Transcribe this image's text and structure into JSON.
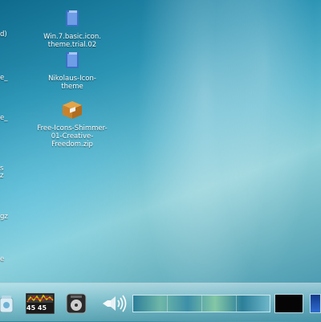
{
  "desktop": {
    "icons": [
      {
        "label_line1": "Win.7.basic.icon.",
        "label_line2": "theme.trial.02"
      },
      {
        "label_line1": "Nikolaus-Icon-",
        "label_line2": "theme"
      },
      {
        "label_line1": "Free-Icons-Shimmer-",
        "label_line2": "01-Creative-",
        "label_line3": "Freedom.zip",
        "badge": "ZIP"
      }
    ],
    "edge_labels": [
      "d)",
      "e_",
      "e_",
      "s",
      "z",
      "gz",
      "e"
    ]
  },
  "taskbar": {
    "clock_label": "45 45"
  }
}
